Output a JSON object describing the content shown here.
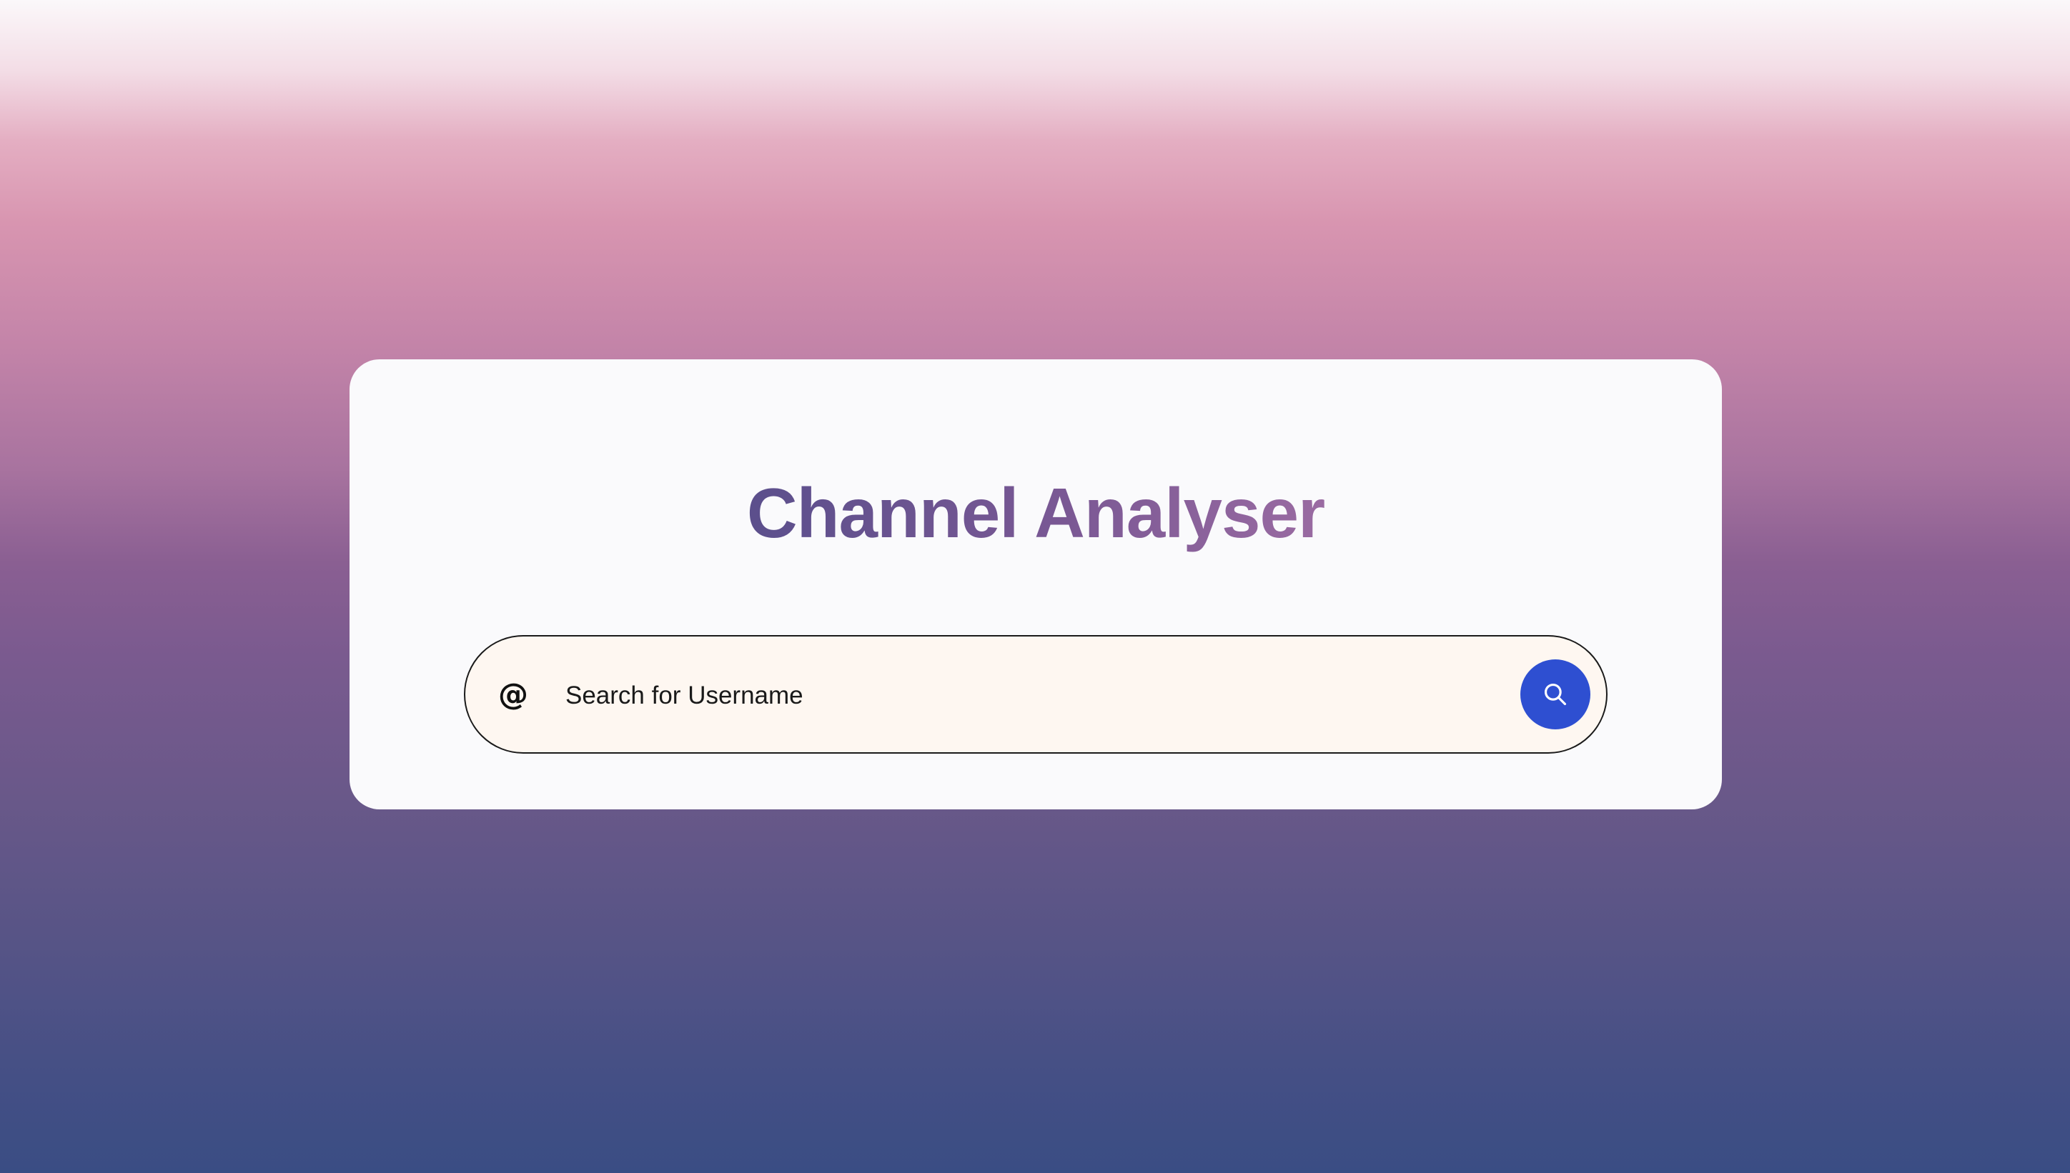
{
  "app": {
    "title": "Channel Analyser"
  },
  "search": {
    "prefix_symbol": "@",
    "placeholder": "Search for Username",
    "value": "",
    "button_icon": "search-icon"
  },
  "colors": {
    "accent": "#2e4fd1",
    "title_gradient_start": "#5b4f8c",
    "title_gradient_end": "#9a6ba2",
    "input_background": "#fef7f1",
    "card_background": "#fafafc"
  }
}
